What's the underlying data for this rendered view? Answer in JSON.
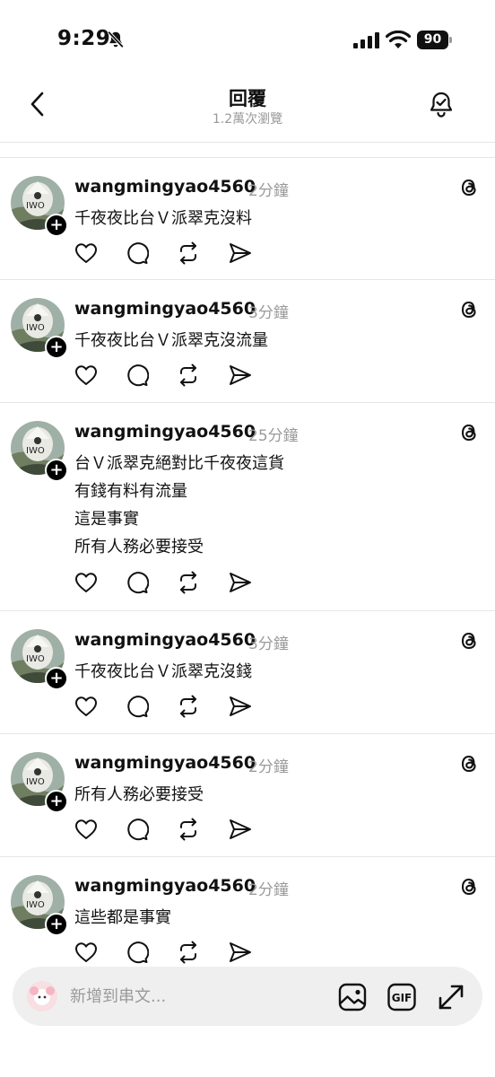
{
  "status_bar": {
    "time": "9:29",
    "battery": "90"
  },
  "header": {
    "title": "回覆",
    "subtitle": "1.2萬次瀏覽"
  },
  "posts": [
    {
      "username": "wangmingyao4560",
      "time": "2分鐘",
      "lines": [
        "千夜夜比台Ｖ派翠克沒料"
      ]
    },
    {
      "username": "wangmingyao4560",
      "time": "3分鐘",
      "lines": [
        "千夜夜比台Ｖ派翠克沒流量"
      ]
    },
    {
      "username": "wangmingyao4560",
      "time": "25分鐘",
      "lines": [
        "台Ｖ派翠克絕對比千夜夜這貨",
        "有錢有料有流量",
        "這是事實",
        "所有人務必要接受"
      ]
    },
    {
      "username": "wangmingyao4560",
      "time": "3分鐘",
      "lines": [
        "千夜夜比台Ｖ派翠克沒錢"
      ]
    },
    {
      "username": "wangmingyao4560",
      "time": "2分鐘",
      "lines": [
        "所有人務必要接受"
      ]
    },
    {
      "username": "wangmingyao4560",
      "time": "2分鐘",
      "lines": [
        "這些都是事實"
      ]
    }
  ],
  "composer": {
    "placeholder": "新增到串文...",
    "gif_label": "GIF"
  },
  "icons": {
    "back": "chevron-left-icon",
    "notify": "bell-check-icon",
    "like": "heart-icon",
    "comment": "comment-icon",
    "repost": "repost-icon",
    "share": "send-icon",
    "threads": "threads-logo-icon",
    "image": "image-icon",
    "expand": "expand-icon"
  },
  "colors": {
    "text": "#111111",
    "muted": "#9a9a9a",
    "composer_bg": "#efefef"
  }
}
